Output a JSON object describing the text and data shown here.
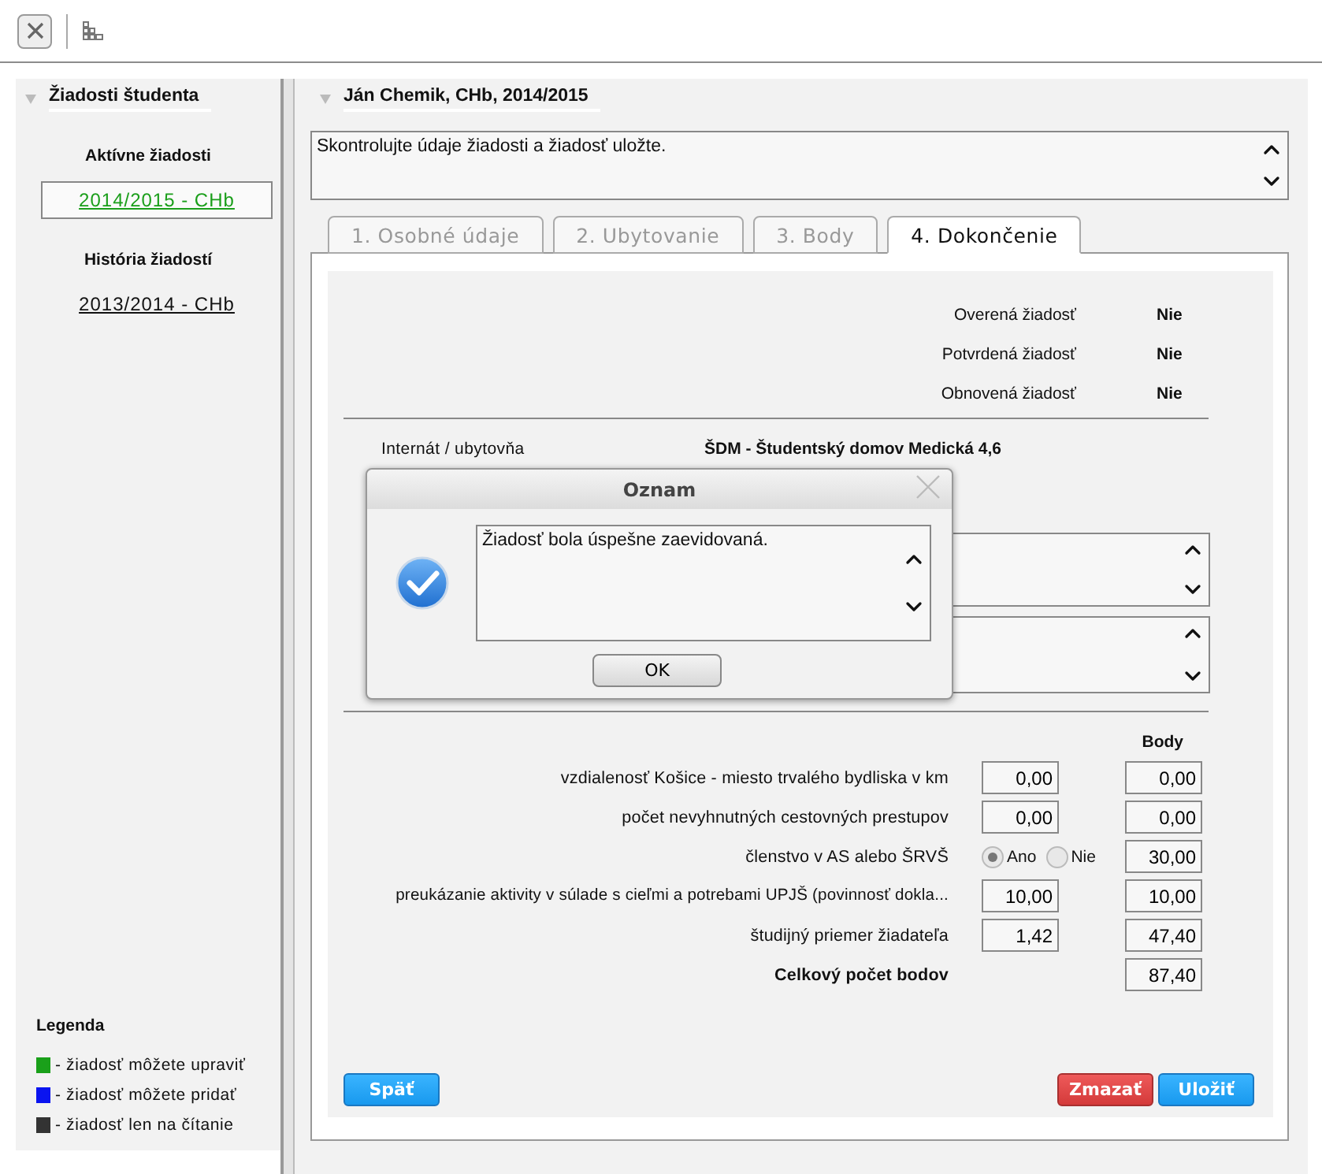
{
  "sidebar": {
    "title": "Žiadosti študenta",
    "sections": [
      {
        "title": "Aktívne žiadosti",
        "items": [
          {
            "label": "2014/2015 - CHb",
            "selected": true
          }
        ]
      },
      {
        "title": "História žiadostí",
        "items": [
          {
            "label": "2013/2014 - CHb",
            "selected": false
          }
        ]
      }
    ],
    "legend": {
      "title": "Legenda",
      "items": [
        {
          "label": "- žiadosť môžete upraviť",
          "color": "#1aa01a"
        },
        {
          "label": "- žiadosť môžete pridať",
          "color": "#0a14f0"
        },
        {
          "label": "- žiadosť len na čítanie",
          "color": "#333333"
        }
      ]
    }
  },
  "main": {
    "title": "Ján Chemik, CHb, 2014/2015",
    "message": "Skontrolujte údaje žiadosti a žiadosť uložte.",
    "tabs": [
      {
        "label": "1. Osobné údaje",
        "selected": false
      },
      {
        "label": "2. Ubytovanie",
        "selected": false
      },
      {
        "label": "3. Body",
        "selected": false
      },
      {
        "label": "4. Dokončenie",
        "selected": true
      }
    ],
    "status": [
      {
        "label": "Overená žiadosť",
        "value": "Nie"
      },
      {
        "label": "Potvrdená žiadosť",
        "value": "Nie"
      },
      {
        "label": "Obnovená žiadosť",
        "value": "Nie"
      }
    ],
    "accommodation": {
      "label": "Internát / ubytovňa",
      "value": "ŠDM - Študentský domov Medická 4,6"
    },
    "scores": {
      "column_heading": "Body",
      "rows": [
        {
          "kind": "input",
          "label": "vzdialenosť Košice - miesto trvalého bydliska v km",
          "input": "0,00",
          "points": "0,00"
        },
        {
          "kind": "input",
          "label": "počet nevyhnutných cestovných prestupov",
          "input": "0,00",
          "points": "0,00"
        },
        {
          "kind": "radio",
          "label": "členstvo v AS alebo ŠRVŠ",
          "options": [
            {
              "label": "Ano",
              "selected": true
            },
            {
              "label": "Nie",
              "selected": false
            }
          ],
          "points": "30,00"
        },
        {
          "kind": "input",
          "label": "preukázanie aktivity v súlade s cieľmi a potrebami UPJŠ (povinnosť dokla...",
          "input": "10,00",
          "points": "10,00"
        },
        {
          "kind": "input",
          "label": "študijný priemer žiadateľa",
          "input": "1,42",
          "points": "47,40"
        },
        {
          "kind": "total",
          "label": "Celkový počet bodov",
          "points": "87,40"
        }
      ]
    },
    "buttons_left": [
      {
        "label": "Späť",
        "kind": "back"
      }
    ],
    "buttons_right": [
      {
        "label": "Zmazať",
        "kind": "delete"
      },
      {
        "label": "Uložiť",
        "kind": "save"
      }
    ]
  },
  "dialog": {
    "title": "Oznam",
    "message": "Žiadosť bola úspešne zaevidovaná.",
    "button": "OK"
  }
}
